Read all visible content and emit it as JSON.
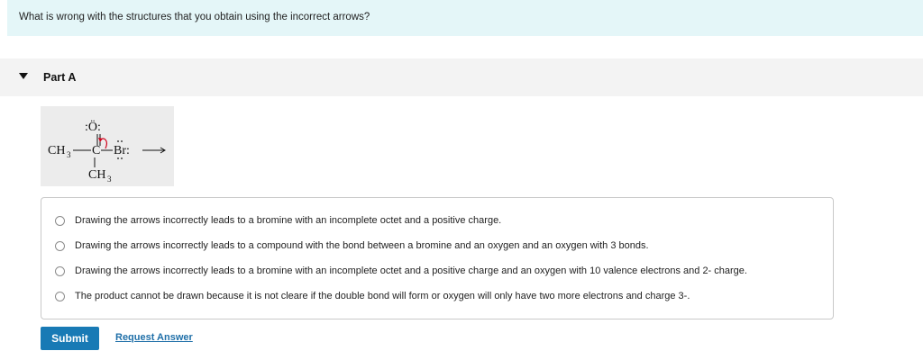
{
  "question": {
    "text": "What is wrong with the structures that you obtain using the incorrect arrows?"
  },
  "part": {
    "label": "Part A",
    "collapse_icon": "caret-down-icon"
  },
  "molecule": {
    "oxygen": ":Ö:",
    "left_group": "CH",
    "left_group_sub": "3",
    "bond": "—",
    "carbon": "C",
    "bromine": "Br:",
    "bottom_group": "CH",
    "bottom_group_sub": "3",
    "arrow_color": "#d0021b"
  },
  "options": [
    {
      "text": "Drawing the arrows incorrectly leads to a bromine with an incomplete octet and a positive charge."
    },
    {
      "text": "Drawing the arrows incorrectly leads to a compound with the bond between a bromine and an oxygen and an oxygen with 3 bonds."
    },
    {
      "text": "Drawing the arrows incorrectly leads to a bromine with an incomplete octet and a positive charge and an oxygen with 10 valence electrons and 2- charge."
    },
    {
      "text": "The product cannot be drawn because it is not cleare if the double bond will form or oxygen will only have two more electrons and charge 3-."
    }
  ],
  "actions": {
    "submit_label": "Submit",
    "request_answer_label": "Request Answer"
  },
  "colors": {
    "question_bg": "#e4f6f8",
    "submit_bg": "#187ab5",
    "link": "#1f6fa8"
  }
}
